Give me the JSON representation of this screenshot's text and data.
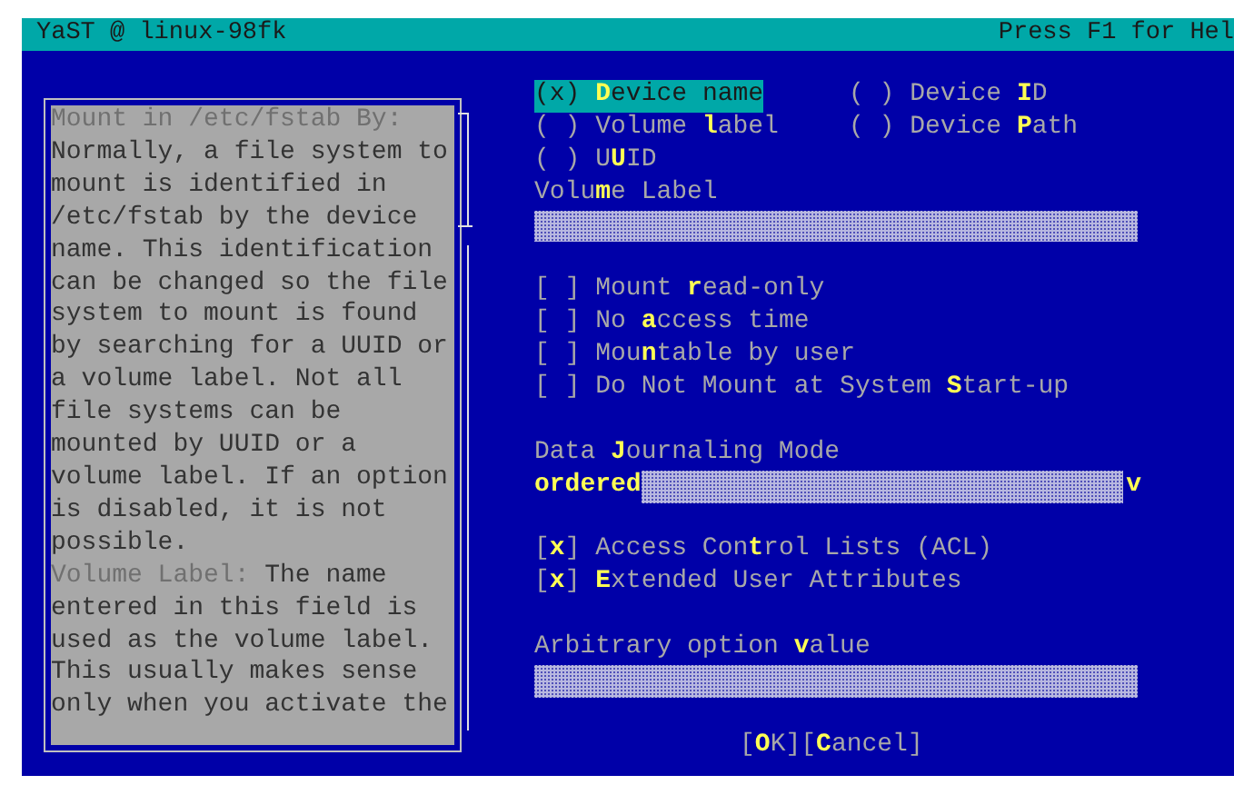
{
  "title_bar": {
    "title": "YaST @ linux-98fk",
    "help_hint": "Press F1 for Hel"
  },
  "help": {
    "paragraphs": [
      {
        "heading": "Mount in /etc/fstab By:",
        "text": "Normally, a file system to mount is identified in /etc/fstab by the device name. This identification can be changed so the file system to mount is found by searching for a UUID or a volume label. Not all file systems can be mounted by UUID or a volume label. If an option is disabled, it is not possible."
      },
      {
        "heading": "Volume Label:",
        "text": "The name entered in this field is used as the volume label. This usually makes sense only when you activate the"
      }
    ]
  },
  "mount_by": {
    "options": [
      {
        "mark": "(x)",
        "label": "**D**evice name",
        "selected": true
      },
      {
        "mark": "( )",
        "label": "Device **I**D",
        "selected": false
      },
      {
        "mark": "( )",
        "label": "Volume **l**abel",
        "selected": false
      },
      {
        "mark": "( )",
        "label": "Device **P**ath",
        "selected": false
      },
      {
        "mark": "( )",
        "label": "U**U**ID",
        "selected": false
      }
    ]
  },
  "volume_label": {
    "label": "Volu**m**e Label"
  },
  "mount_options": [
    {
      "mark": "[ ]",
      "label": "Mount **r**ead-only",
      "checked": false
    },
    {
      "mark": "[ ]",
      "label": "No **a**ccess time",
      "checked": false
    },
    {
      "mark": "[ ]",
      "label": "Mou**n**table by user",
      "checked": false
    },
    {
      "mark": "[ ]",
      "label": "Do Not Mount at System **S**tart-up",
      "checked": false
    }
  ],
  "journaling": {
    "label": "Data **J**ournaling Mode",
    "value": "ordered",
    "arrow": "v"
  },
  "acl_options": [
    {
      "mark": "[x]",
      "label": "Access Con**t**rol Lists (ACL)",
      "checked": true
    },
    {
      "mark": "[x]",
      "label": "**E**xtended User Attributes",
      "checked": true
    }
  ],
  "arbitrary": {
    "label": "Arbitrary option **v**alue"
  },
  "buttons": [
    {
      "label": "[**O**K]"
    },
    {
      "label": "[**C**ancel]"
    }
  ]
}
